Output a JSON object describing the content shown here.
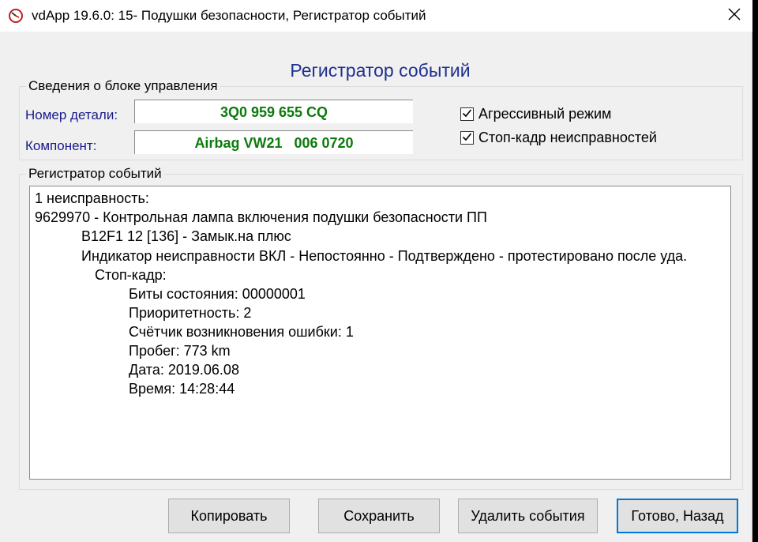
{
  "window": {
    "title": "vdApp 19.6.0: 15- Подушки безопасности,  Регистратор событий"
  },
  "dialog": {
    "heading": "Регистратор событий"
  },
  "control_unit": {
    "group_label": "Сведения о блоке управления",
    "part_number_label": "Номер детали:",
    "part_number_value": "3Q0 959 655 CQ",
    "component_label": "Компонент:",
    "component_value": "Airbag VW21   006 0720"
  },
  "options": {
    "aggressive_mode": {
      "label": "Агрессивный режим",
      "checked": true
    },
    "freeze_frame": {
      "label": "Стоп-кадр неисправностей",
      "checked": true
    }
  },
  "event_log": {
    "group_label": "Регистратор событий",
    "lines": [
      "1 неисправность:",
      "9629970 - Контрольная лампа включения подушки безопасности ПП",
      "B12F1 12 [136] - Замык.на плюс",
      "Индикатор неисправности ВКЛ - Непостоянно - Подтверждено - протестировано после уда.",
      "Стоп-кадр:",
      "Биты состояния: 00000001",
      "Приоритетность: 2",
      "Счётчик возникновения ошибки: 1",
      "Пробег: 773 km",
      "Дата: 2019.06.08",
      "Время: 14:28:44"
    ]
  },
  "buttons": {
    "copy": "Копировать",
    "save": "Сохранить",
    "delete_events": "Удалить события",
    "done_back": "Готово, Назад"
  },
  "colors": {
    "accent": "#0078d7",
    "value_green": "#0c7a0c",
    "label_blue": "#1a1a8f",
    "heading_blue": "#1f2f8f"
  }
}
